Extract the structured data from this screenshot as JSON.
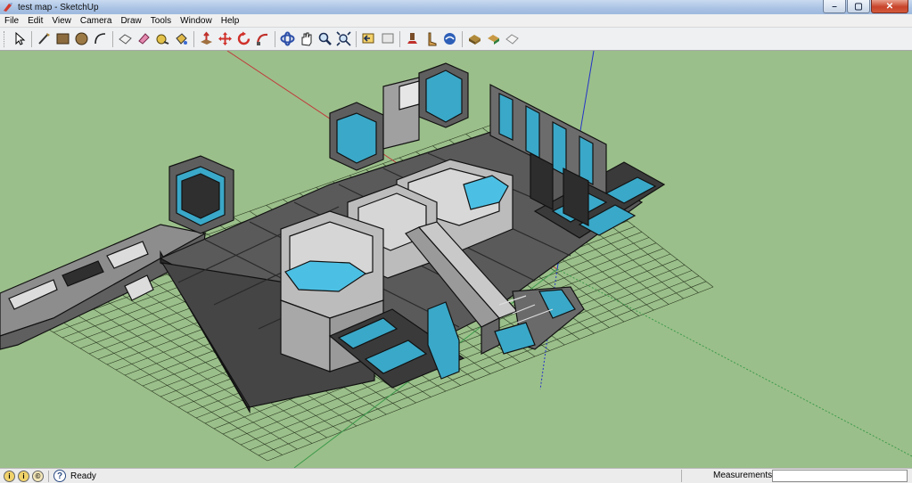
{
  "window": {
    "title": "test map - SketchUp",
    "minimize_glyph": "–",
    "maximize_glyph": "▢",
    "close_glyph": "✕"
  },
  "menu": {
    "items": [
      {
        "label": "File"
      },
      {
        "label": "Edit"
      },
      {
        "label": "View"
      },
      {
        "label": "Camera"
      },
      {
        "label": "Draw"
      },
      {
        "label": "Tools"
      },
      {
        "label": "Window"
      },
      {
        "label": "Help"
      }
    ]
  },
  "toolbar": {
    "tools": [
      "select-icon",
      "line-icon",
      "rectangle-icon",
      "circle-icon",
      "arc-icon",
      "make-component-icon",
      "eraser-icon",
      "tape-measure-icon",
      "paint-bucket-icon",
      "push-pull-icon",
      "move-icon",
      "rotate-icon",
      "follow-me-icon",
      "orbit-icon",
      "pan-icon",
      "zoom-icon",
      "zoom-extents-icon",
      "previous-view-icon",
      "next-view-icon",
      "position-camera-icon",
      "walk-icon",
      "look-around-icon",
      "get-models-icon",
      "share-model-icon",
      "share-component-icon"
    ]
  },
  "viewport": {
    "background_color": "#9bbf8a",
    "grid_color": "#2a3a22",
    "accent_color": "#3aa8c8",
    "axis_colors": {
      "red": "#c0393b",
      "green": "#3c9a4b",
      "blue": "#2434c8"
    }
  },
  "status": {
    "text": "Ready",
    "help_glyph": "?",
    "icon1_glyph": "i",
    "icon2_glyph": "i",
    "icon3_glyph": "©",
    "measurements_label": "Measurements",
    "measurements_value": ""
  }
}
